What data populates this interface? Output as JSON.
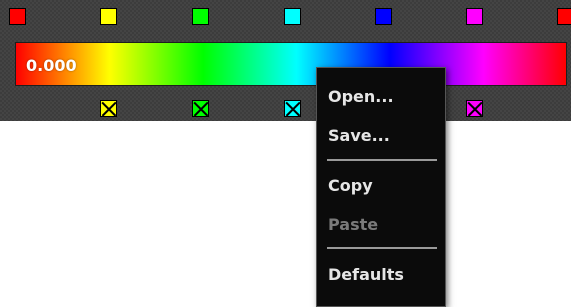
{
  "gradient_editor": {
    "value_display": "0.000",
    "top_stops": [
      {
        "color": "#ff0000"
      },
      {
        "color": "#ffff00"
      },
      {
        "color": "#00ff00"
      },
      {
        "color": "#00ffff"
      },
      {
        "color": "#0000ff"
      },
      {
        "color": "#ff00ff"
      },
      {
        "color": "#ff0000"
      }
    ],
    "bottom_stops": [
      {
        "color": "#ffff00"
      },
      {
        "color": "#00ff00"
      },
      {
        "color": "#00ffff"
      },
      {
        "color": "#ff00ff"
      }
    ]
  },
  "context_menu": {
    "open_label": "Open...",
    "save_label": "Save...",
    "copy_label": "Copy",
    "paste_label": "Paste",
    "defaults_label": "Defaults"
  }
}
